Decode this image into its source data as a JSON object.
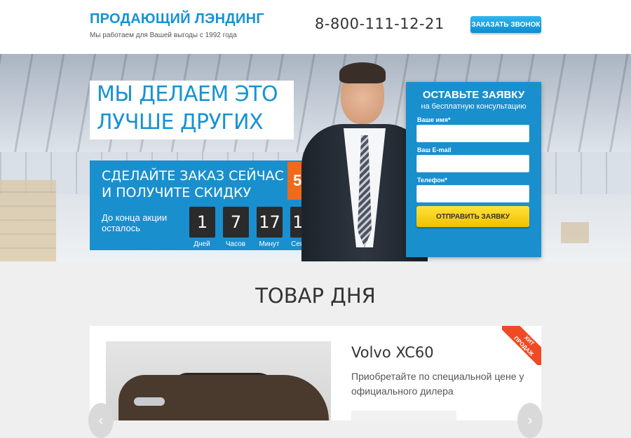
{
  "header": {
    "brand_title": "ПРОДАЮЩИЙ ЛЭНДИНГ",
    "brand_subtitle": "Мы работаем для Вашей выгоды с 1992 года",
    "phone": "8-800-111-12-21",
    "callback_label": "ЗАКАЗАТЬ ЗВОНОК"
  },
  "hero": {
    "headline_line1": "МЫ ДЕЛАЕМ ЭТО",
    "headline_line2": "ЛУЧШЕ ДРУГИХ",
    "promo_line1": "СДЕЛАЙТЕ ЗАКАЗ СЕЙЧАС",
    "promo_line2": "И ПОЛУЧИТЕ СКИДКУ",
    "discount": "50%",
    "countdown_line1": "До конца акции",
    "countdown_line2": "осталось",
    "timer": [
      {
        "value": "1",
        "unit": "Дней"
      },
      {
        "value": "7",
        "unit": "Часов"
      },
      {
        "value": "17",
        "unit": "Минут"
      },
      {
        "value": "17",
        "unit": "Секунд"
      }
    ]
  },
  "form": {
    "title": "ОСТАВЬТЕ ЗАЯВКУ",
    "subtitle": "на бесплатную консультацию",
    "name_label": "Ваше имя*",
    "email_label": "Ваш E-mail",
    "phone_label": "Телефон*",
    "submit_label": "ОТПРАВИТЬ ЗАЯВКУ"
  },
  "product_section": {
    "title": "ТОВАР ДНЯ",
    "product_name": "Volvo XC60",
    "product_description": "Приобретайте по специальной цене у официального дилера",
    "ribbon_line1": "ХИТ",
    "ribbon_line2": "ПРОДАЖ"
  },
  "icons": {
    "prev": "chevron-left-icon",
    "next": "chevron-right-icon"
  },
  "colors": {
    "accent_blue": "#1693d4",
    "promo_blue": "#1a8fce",
    "discount_orange": "#ef6a1b",
    "submit_yellow": "#f0c000",
    "ribbon_red": "#ef4a23"
  }
}
